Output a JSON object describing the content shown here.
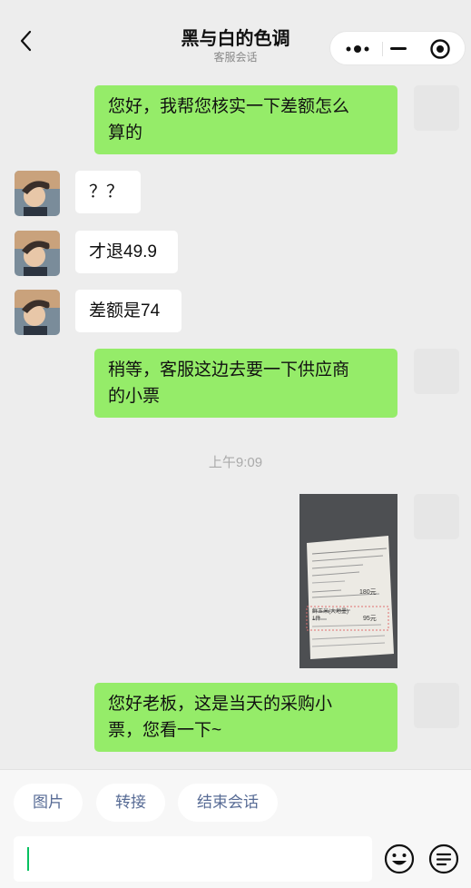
{
  "header": {
    "title": "黑与白的色调",
    "subtitle": "客服会话",
    "back_icon": "chevron-left-icon",
    "more_icon": "more-dots-icon",
    "minimize_icon": "minimize-icon",
    "close_icon": "target-close-icon"
  },
  "messages": [
    {
      "side": "self",
      "type": "text",
      "lines": [
        "您好，我帮您核实一下差额怎么",
        "算的"
      ]
    },
    {
      "side": "other",
      "type": "text",
      "lines": [
        "？？"
      ]
    },
    {
      "side": "other",
      "type": "text",
      "lines": [
        "才退49.9"
      ]
    },
    {
      "side": "other",
      "type": "text",
      "lines": [
        "差额是74"
      ]
    },
    {
      "side": "self",
      "type": "text",
      "lines": [
        "稍等，客服这边去要一下供应商",
        "的小票"
      ]
    },
    {
      "type": "time",
      "text": "上午9:09"
    },
    {
      "side": "self",
      "type": "image",
      "desc": "receipt photo",
      "receipt_text": {
        "order_no": "订单号：8822591700004​6",
        "price1": "180元",
        "item": "鲜玉米(大地墨)",
        "qty": "1件",
        "price2": "95元"
      }
    },
    {
      "side": "self",
      "type": "text",
      "lines": [
        "您好老板，这是当天的采购小",
        "票，您看一下~"
      ]
    }
  ],
  "quick_actions": [
    "图片",
    "转接",
    "结束会话"
  ],
  "input": {
    "value": ""
  },
  "icons": {
    "emoji": "emoji-icon",
    "menu": "menu-lines-icon"
  },
  "colors": {
    "self_bubble": "#95ec69",
    "other_bubble": "#ffffff",
    "background": "#ededed",
    "link": "#576b95",
    "caret": "#07c160"
  }
}
